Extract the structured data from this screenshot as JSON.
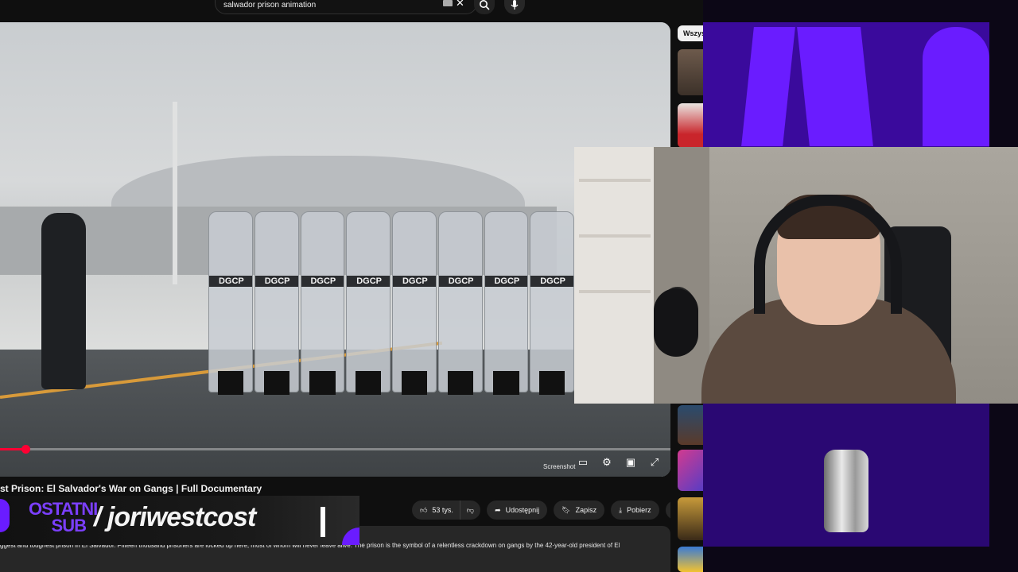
{
  "search": {
    "value": "salwador prison animation"
  },
  "video": {
    "title": "st Prison: El Salvador's War on Gangs | Full Documentary",
    "progress_fraction": 0.038,
    "shield_tags": [
      "DGCP",
      "DGCP",
      "DGCP",
      "DGCP",
      "DGCP",
      "DGCP",
      "DGCP",
      "DGCP"
    ],
    "screenshot_label": "Screenshot"
  },
  "actions": {
    "like_count": "53 tys.",
    "share": "Udostępnij",
    "save": "Zapisz",
    "download": "Pobierz"
  },
  "description": "ggest and toughest prison in El Salvador. Fifteen thousand prisoners are locked up here, most of whom will never leave alive. The prison is the symbol of a relentless crackdown on gangs by the 42-year-old president of El",
  "sidebar": {
    "chip": "Wszys"
  },
  "overlay": {
    "sub_label": "OSTATNI SUB",
    "sub_name": "/ joriwestcost"
  },
  "colors": {
    "accent": "#6a1cff",
    "progress": "#ff0033"
  }
}
